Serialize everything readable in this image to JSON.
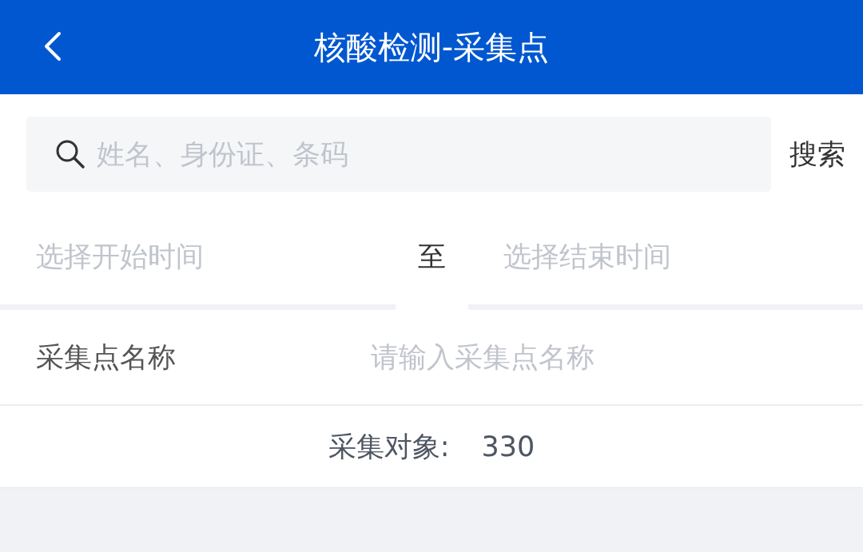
{
  "header": {
    "title": "核酸检测-采集点"
  },
  "search": {
    "placeholder": "姓名、身份证、条码",
    "button": "搜索"
  },
  "date_range": {
    "start_placeholder": "选择开始时间",
    "separator": "至",
    "end_placeholder": "选择结束时间"
  },
  "site_name": {
    "label": "采集点名称",
    "placeholder": "请输入采集点名称"
  },
  "summary": {
    "label": "采集对象:",
    "count": "330"
  }
}
